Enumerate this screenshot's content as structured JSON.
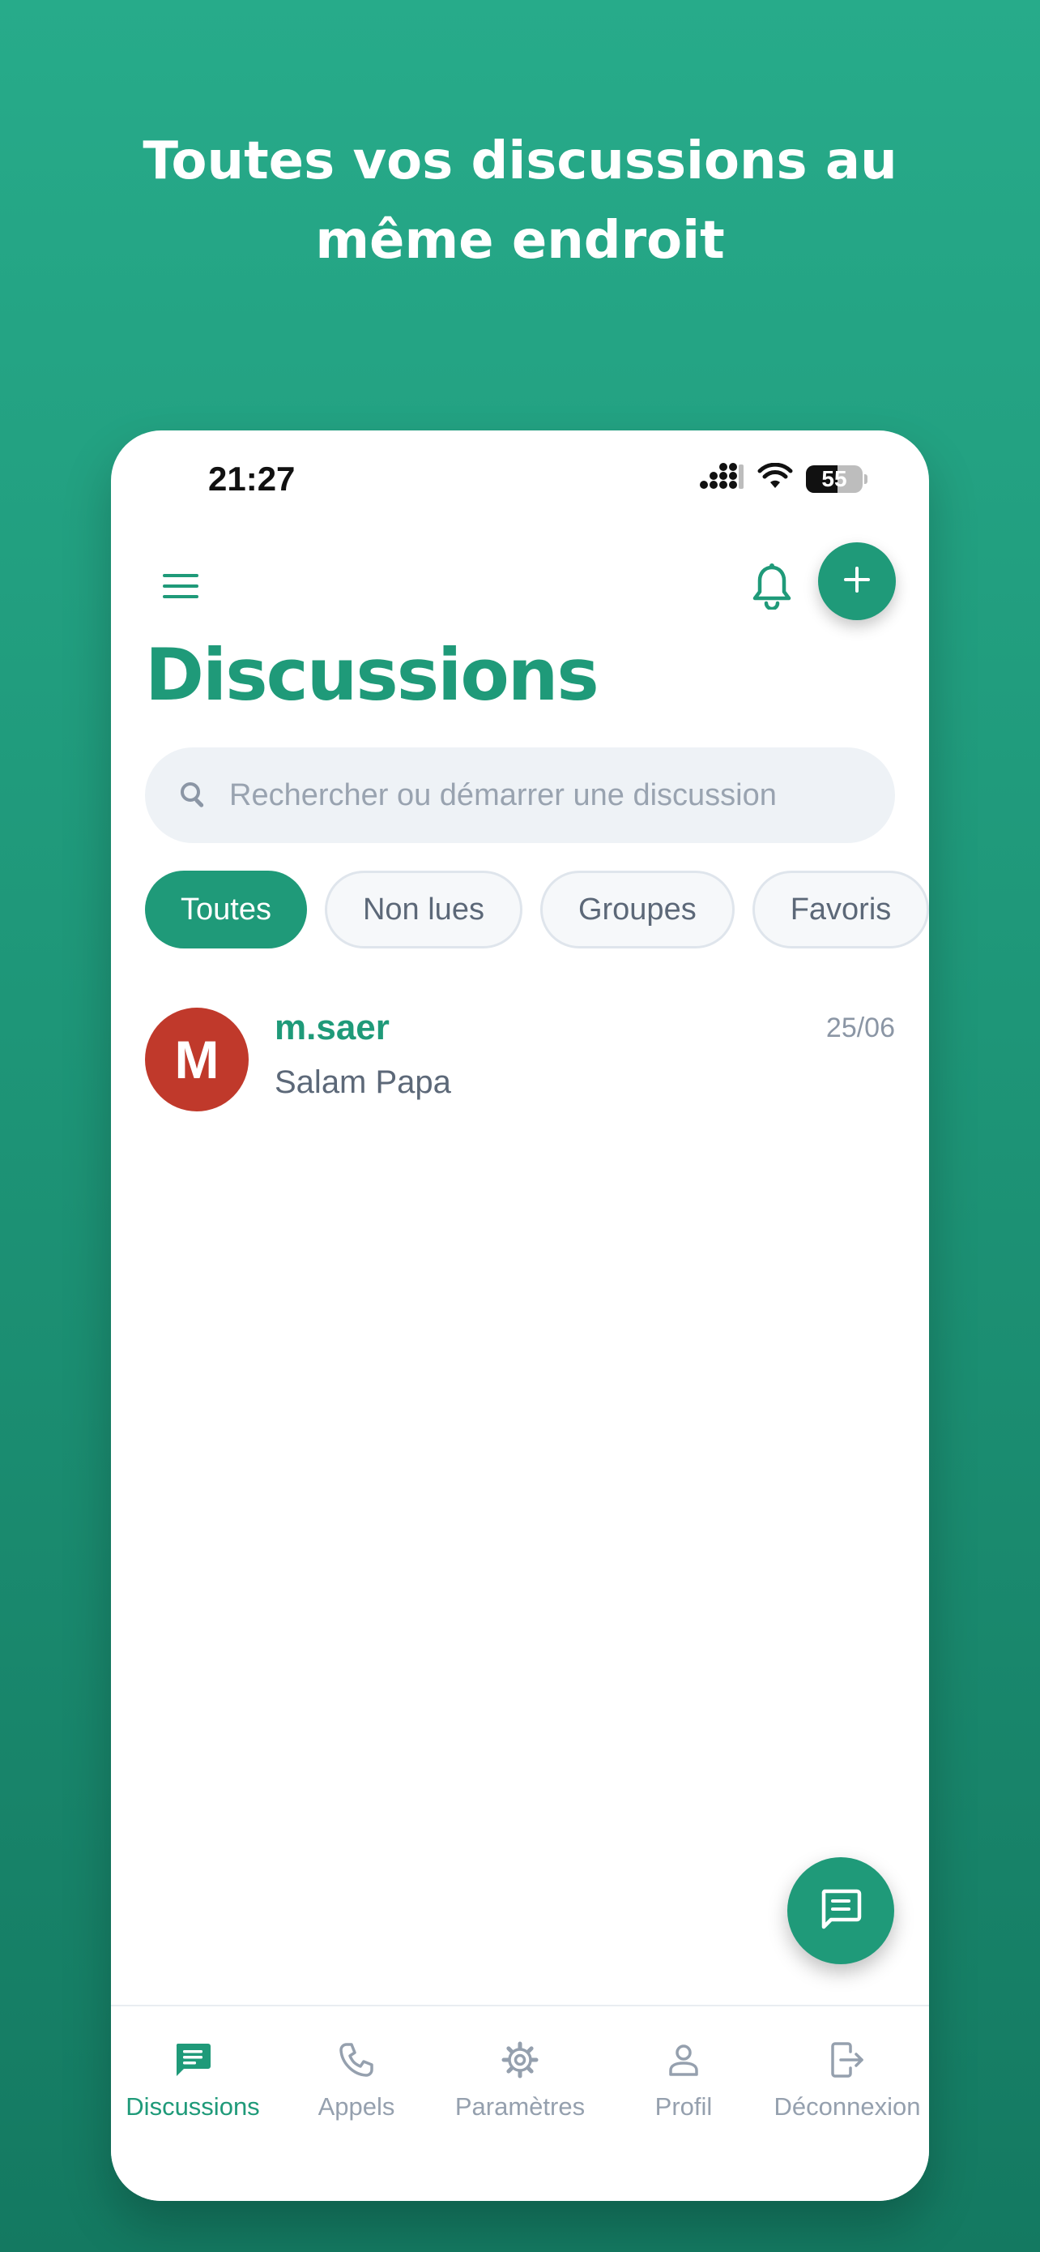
{
  "headline": {
    "line1": "Toutes vos discussions au",
    "line2": "même endroit"
  },
  "status_bar": {
    "time": "21:27",
    "battery_percent": "55",
    "battery_level": 0.55
  },
  "header": {
    "title": "Discussions"
  },
  "search": {
    "placeholder": "Rechercher ou démarrer une discussion"
  },
  "filters": [
    {
      "label": "Toutes",
      "active": true
    },
    {
      "label": "Non lues",
      "active": false
    },
    {
      "label": "Groupes",
      "active": false
    },
    {
      "label": "Favoris",
      "active": false
    }
  ],
  "conversations": [
    {
      "avatar_initial": "M",
      "avatar_color": "#c0392b",
      "name": "m.saer",
      "preview": "Salam Papa",
      "date": "25/06"
    }
  ],
  "bottom_nav": [
    {
      "label": "Discussions",
      "icon": "chat-icon",
      "active": true
    },
    {
      "label": "Appels",
      "icon": "phone-icon",
      "active": false
    },
    {
      "label": "Paramètres",
      "icon": "gear-icon",
      "active": false
    },
    {
      "label": "Profil",
      "icon": "person-icon",
      "active": false
    },
    {
      "label": "Déconnexion",
      "icon": "logout-icon",
      "active": false
    }
  ],
  "colors": {
    "accent": "#1f9a79",
    "background_top": "#27ab8a",
    "background_bottom": "#147961",
    "muted_text": "#95a0ae"
  }
}
